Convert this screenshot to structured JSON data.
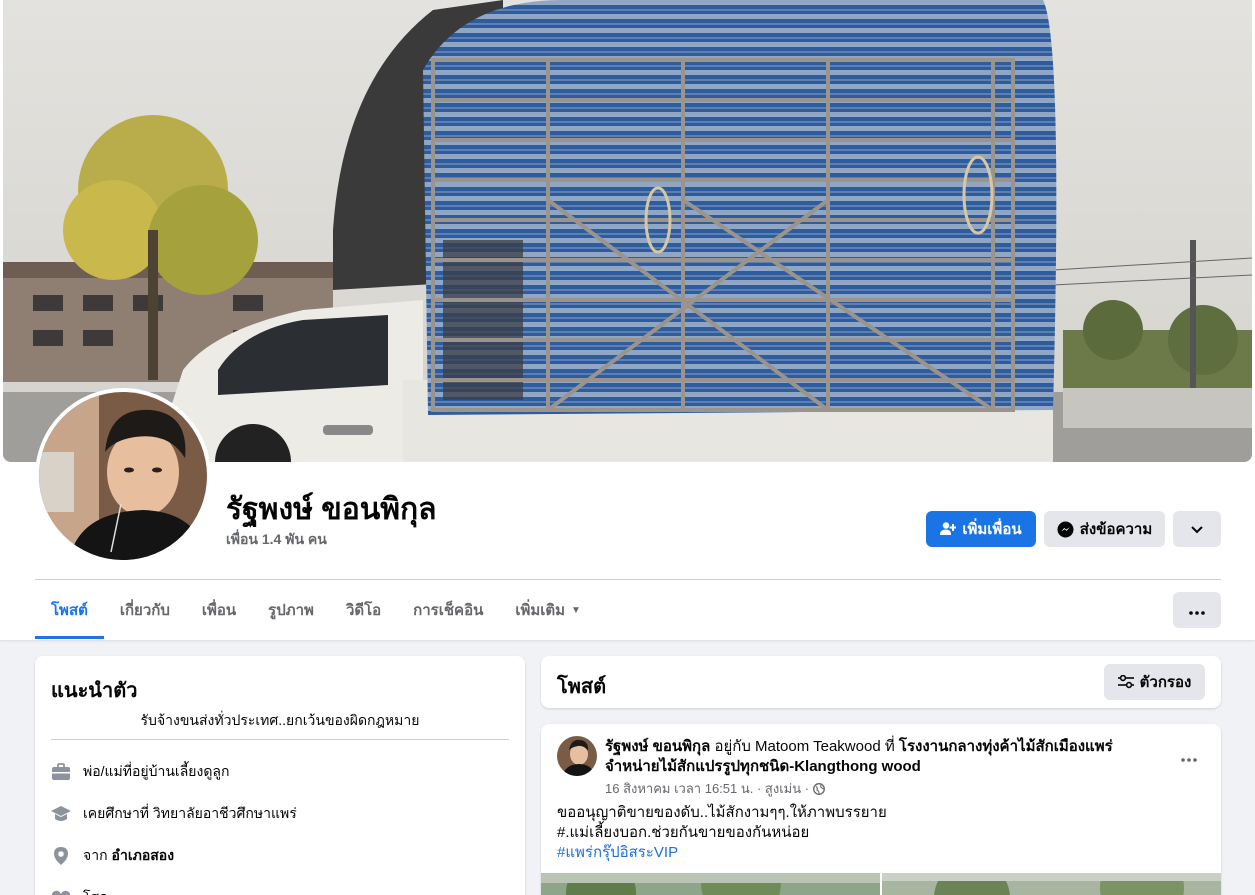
{
  "profile": {
    "name": "รัฐพงษ์ ขอนพิกุล",
    "friends": "เพื่อน 1.4 พัน คน"
  },
  "actions": {
    "add_friend": "เพิ่มเพื่อน",
    "message": "ส่งข้อความ"
  },
  "tabs": [
    {
      "label": "โพสต์",
      "active": true
    },
    {
      "label": "เกี่ยวกับ"
    },
    {
      "label": "เพื่อน"
    },
    {
      "label": "รูปภาพ"
    },
    {
      "label": "วิดีโอ"
    },
    {
      "label": "การเช็คอิน"
    },
    {
      "label": "เพิ่มเติม"
    }
  ],
  "intro": {
    "title": "แนะนำตัว",
    "bio": "รับจ้างขนส่งทั่วประเทศ..ยกเว้นของผิดกฎหมาย",
    "items": [
      {
        "icon": "briefcase-icon",
        "text": "พ่อ/แม่ที่อยู่บ้านเลี้ยงดูลูก",
        "bold": ""
      },
      {
        "icon": "graduation-cap-icon",
        "text": "เคยศึกษาที่ วิทยาลัยอาชีวศึกษาแพร่",
        "bold": ""
      },
      {
        "icon": "location-pin-icon",
        "text": "จาก",
        "bold": "อำเภอสอง"
      },
      {
        "icon": "heart-icon",
        "text": "โสด",
        "bold": ""
      }
    ]
  },
  "posts": {
    "title": "โพสต์",
    "filter_label": "ตัวกรอง",
    "item": {
      "author": "รัฐพงษ์ ขอนพิกุล",
      "with_text": "อยู่กับ",
      "with_name": "Matoom Teakwood",
      "at_text": "ที่",
      "place": "โรงงานกลางทุ่งค้าไม้สักเมืองแพร่ จำหน่ายไม้สักแปรรูปทุกชนิด-Klangthong wood",
      "meta": "16 สิงหาคม เวลา 16:51 น. · สูงเม่น ·",
      "line1": "ขออนุญาติขายของดับ..ไม้สักงามๆๆ.ให้ภาพบรรยาย",
      "line2": "#.แม่เลี้ยงบอก.ช่วยกันขายของกันหน่อย",
      "hashtag": "#แพร่กรุ๊ปอิสระVIP"
    }
  },
  "colors": {
    "accent": "#1b74e4",
    "background": "#f0f2f5",
    "secondary_button": "#e4e6eb",
    "muted_text": "#65676b"
  }
}
